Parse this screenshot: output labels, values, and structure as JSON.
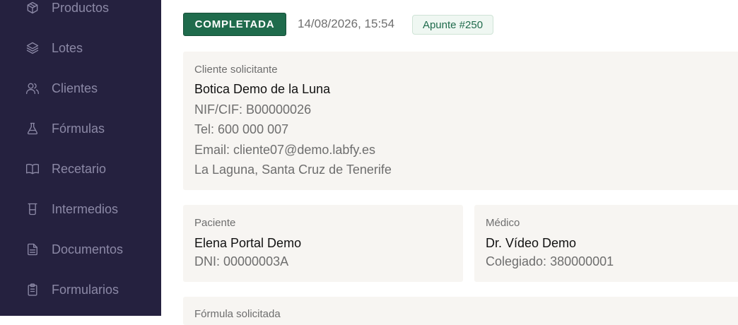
{
  "sidebar": {
    "items": [
      {
        "label": "Productos",
        "icon": "box-icon"
      },
      {
        "label": "Lotes",
        "icon": "layers-icon"
      },
      {
        "label": "Clientes",
        "icon": "users-icon"
      },
      {
        "label": "Fórmulas",
        "icon": "flask-icon"
      },
      {
        "label": "Recetario",
        "icon": "book-open-icon"
      },
      {
        "label": "Intermedios",
        "icon": "beaker-icon"
      },
      {
        "label": "Documentos",
        "icon": "document-icon"
      },
      {
        "label": "Formularios",
        "icon": "clipboard-icon"
      }
    ]
  },
  "header": {
    "status": "COMPLETADA",
    "timestamp": "14/08/2026, 15:54",
    "reference": "Apunte #250"
  },
  "client": {
    "label": "Cliente solicitante",
    "name": "Botica Demo de la Luna",
    "tax_id": "NIF/CIF: B00000026",
    "phone": "Tel: 600 000 007",
    "email": "Email: cliente07@demo.labfy.es",
    "location": "La Laguna, Santa Cruz de Tenerife"
  },
  "patient": {
    "label": "Paciente",
    "name": "Elena Portal Demo",
    "id": "DNI: 00000003A"
  },
  "doctor": {
    "label": "Médico",
    "name": "Dr. Vídeo Demo",
    "registration": "Colegiado: 380000001"
  },
  "formula": {
    "label": "Fórmula solicitada"
  },
  "colors": {
    "sidebar_bg": "#25213f",
    "sidebar_text": "#8c89a6",
    "accent": "#1f6b4c",
    "card_bg": "#f7f5f2"
  }
}
